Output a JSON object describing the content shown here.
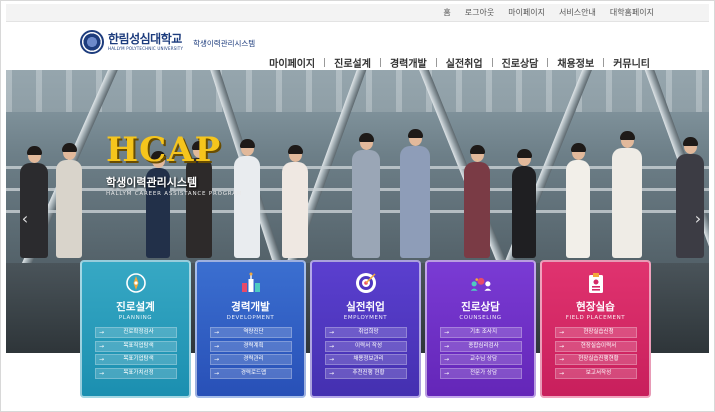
{
  "util_nav": [
    "홈",
    "로그아웃",
    "마이페이지",
    "서비스안내",
    "대학홈페이지"
  ],
  "logo": {
    "name_ko": "한림성심대학교",
    "name_en": "HALLYM POLYTECHNIC UNIVERSITY",
    "system": "학생이력관리시스템"
  },
  "main_nav": [
    "마이페이지",
    "진로설계",
    "경력개발",
    "실전취업",
    "진로상담",
    "채용정보",
    "커뮤니티"
  ],
  "hero": {
    "brand": "HCAP",
    "title": "학생이력관리시스템",
    "subtitle": "HALLYM CAREER ASSISTANCE PROGRAM",
    "prev_icon": "chevron-left-icon",
    "next_icon": "chevron-right-icon"
  },
  "cards": [
    {
      "title": "진로설계",
      "subtitle": "PLANNING",
      "icon": "compass-icon",
      "color": "#2a9bbd",
      "items": [
        "진로확정검사",
        "목표직업탐색",
        "목표기업탐색",
        "목표가치선정"
      ]
    },
    {
      "title": "경력개발",
      "subtitle": "DEVELOPMENT",
      "icon": "flask-icon",
      "color": "#3160c4",
      "items": [
        "역량진단",
        "경력계획",
        "경력관리",
        "경력로드맵"
      ]
    },
    {
      "title": "실전취업",
      "subtitle": "EMPLOYMENT",
      "icon": "target-icon",
      "color": "#4f37c0",
      "items": [
        "취업희망",
        "이력서 작성",
        "채용정보관리",
        "추천진행 현황"
      ]
    },
    {
      "title": "진로상담",
      "subtitle": "COUNSELING",
      "icon": "people-icon",
      "color": "#6e30c6",
      "items": [
        "기초 조사지",
        "종합심리검사",
        "교수님 상담",
        "전문가 상담"
      ]
    },
    {
      "title": "현장실습",
      "subtitle": "FIELD PLACEMENT",
      "icon": "badge-icon",
      "color": "#d42966",
      "items": [
        "현장실습신청",
        "현장실습이력서",
        "현장실습진행현황",
        "보고서작성"
      ]
    }
  ]
}
